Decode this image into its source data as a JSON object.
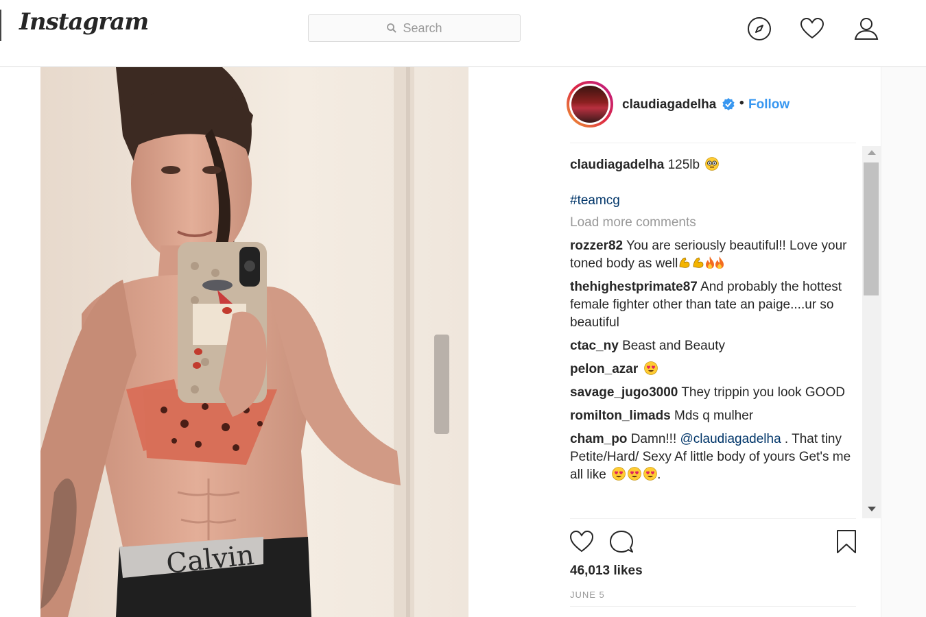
{
  "header": {
    "logo": "Instagram",
    "search_placeholder": "Search",
    "icons": [
      "compass-icon",
      "heart-icon",
      "profile-icon"
    ]
  },
  "post": {
    "owner": "claudiagadelha",
    "follow_label": "Follow",
    "separator": "•",
    "caption": {
      "username": "claudiagadelha",
      "text": "125lb",
      "hashtag": "#teamcg"
    },
    "load_more_label": "Load more comments",
    "comments": [
      {
        "username": "rozzer82",
        "text": "You are seriously beautiful!! Love your toned body as well"
      },
      {
        "username": "thehighestprimate87",
        "text": "And probably the hottest female fighter other than tate an paige....ur so beautiful"
      },
      {
        "username": "ctac_ny",
        "text": "Beast and Beauty"
      },
      {
        "username": "pelon_azar",
        "text": ""
      },
      {
        "username": "savage_jugo3000",
        "text": "They trippin you look GOOD"
      },
      {
        "username": "romilton_limads",
        "text": "Mds q mulher"
      },
      {
        "username": "cham_po",
        "text_before": "Damn!!!",
        "mention": "@claudiagadelha",
        "text_after": ". That tiny Petite/Hard/ Sexy Af little body of yours Get's me all like",
        "text_end": "."
      }
    ],
    "likes": "46,013 likes",
    "date": "JUNE 5"
  },
  "colors": {
    "link": "#3897f0",
    "hashtag": "#003569",
    "muted": "#999999",
    "border": "#dbdbdb"
  }
}
